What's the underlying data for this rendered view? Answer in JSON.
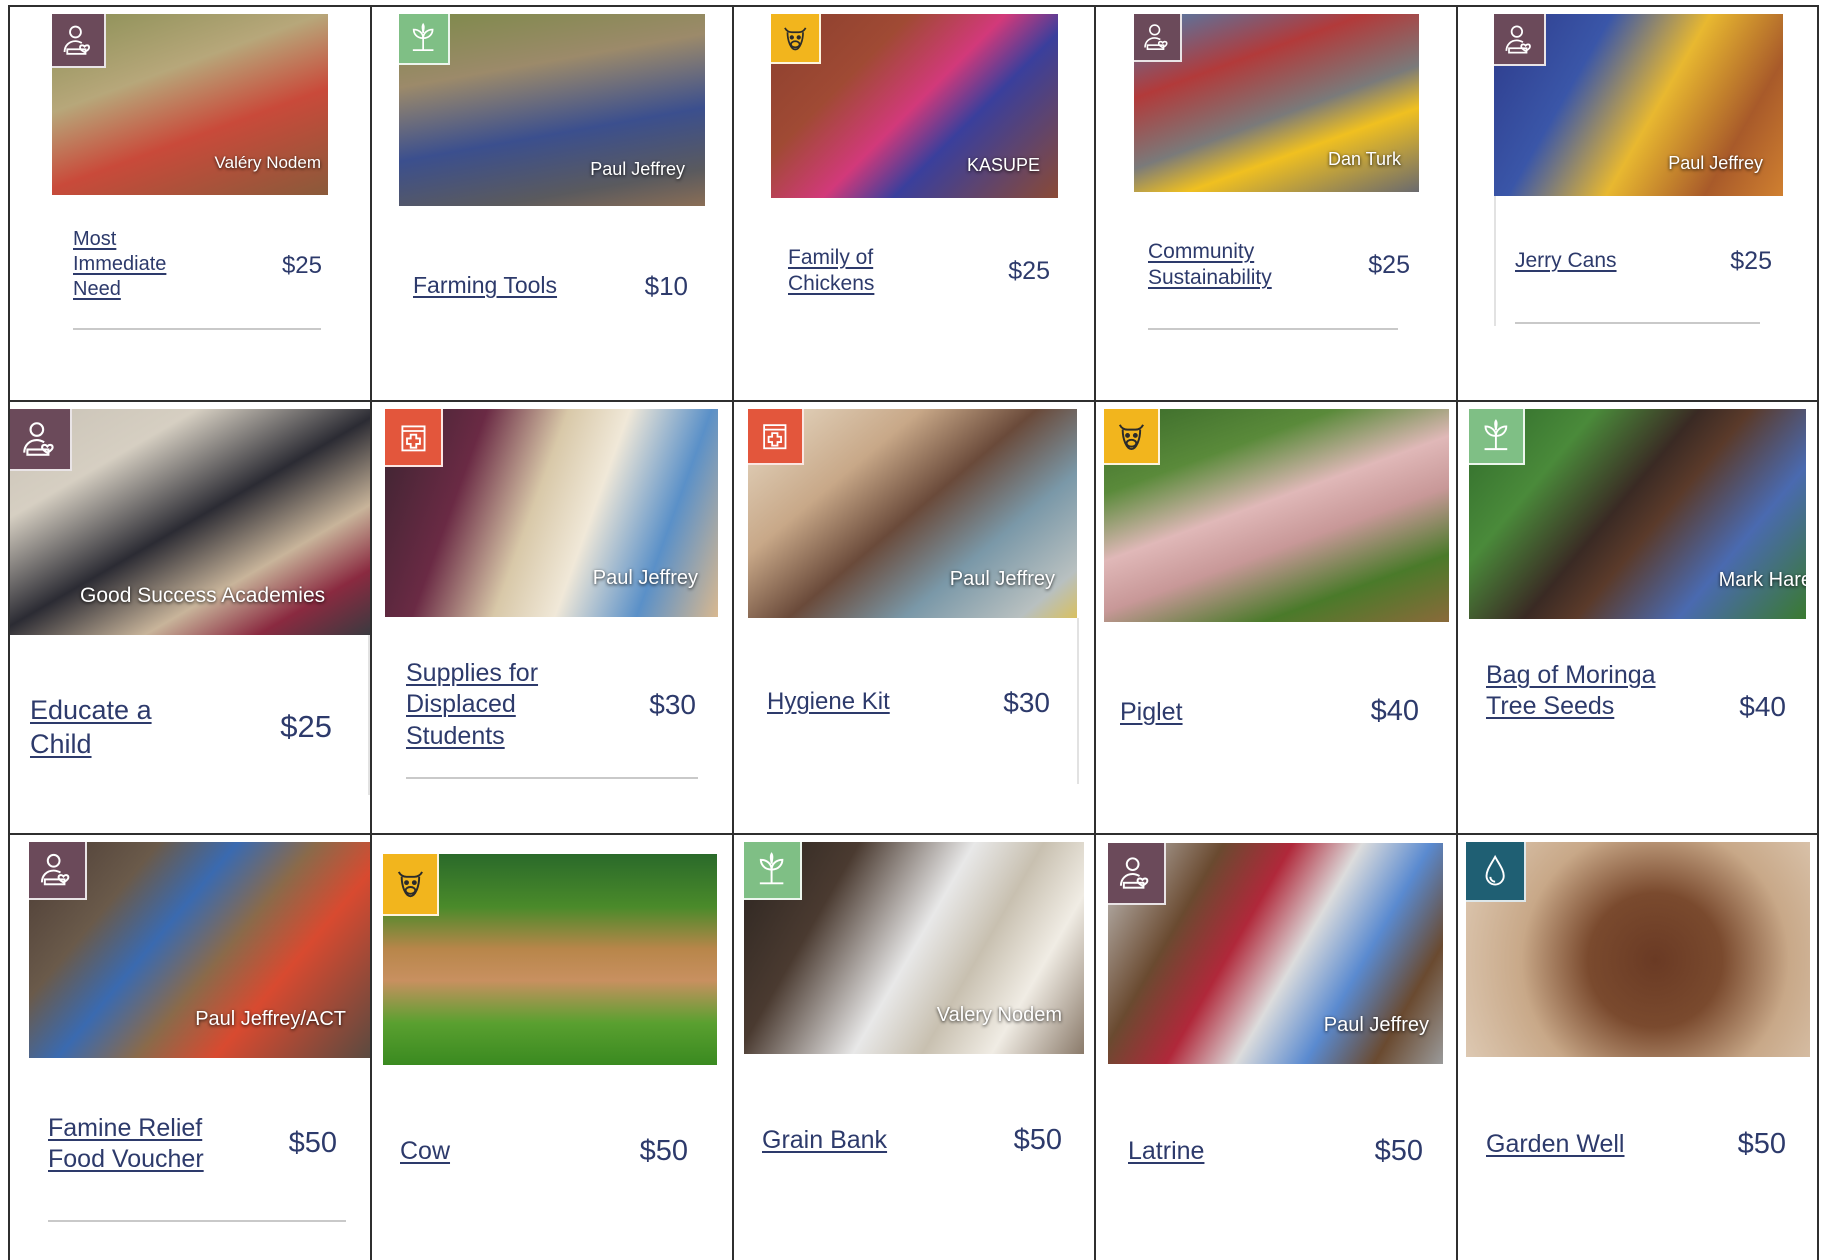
{
  "colors": {
    "text_navy": "#2d3a6b",
    "grid_line": "#2f2f2f",
    "badge_person": "#6b4a5a",
    "badge_plant": "#7fbf85",
    "badge_animal": "#f2b51d",
    "badge_health": "#e3563c",
    "badge_water": "#1f5f73"
  },
  "gifts": [
    {
      "name": "Most Immediate Need",
      "price": "$25",
      "credit": "Valéry Nodem",
      "icon": "person-heart-icon"
    },
    {
      "name": "Farming Tools",
      "price": "$10",
      "credit": "Paul Jeffrey",
      "icon": "seedling-icon"
    },
    {
      "name": "Family of Chickens",
      "price": "$25",
      "credit": "KASUPE",
      "icon": "cow-icon"
    },
    {
      "name": "Community Sustainability",
      "price": "$25",
      "credit": "Dan Turk",
      "icon": "person-heart-icon"
    },
    {
      "name": "Jerry Cans",
      "price": "$25",
      "credit": "Paul Jeffrey",
      "icon": "person-heart-icon"
    },
    {
      "name": "Educate a Child",
      "price": "$25",
      "credit": "Good Success Academies",
      "icon": "person-heart-icon"
    },
    {
      "name": "Supplies for Displaced Students",
      "price": "$30",
      "credit": "Paul Jeffrey",
      "icon": "medical-cross-icon"
    },
    {
      "name": "Hygiene Kit",
      "price": "$30",
      "credit": "Paul Jeffrey",
      "icon": "medical-cross-icon"
    },
    {
      "name": "Piglet",
      "price": "$40",
      "credit": "",
      "icon": "cow-icon"
    },
    {
      "name": "Bag of Moringa Tree Seeds",
      "price": "$40",
      "credit": "Mark Hare",
      "icon": "seedling-icon"
    },
    {
      "name": "Famine Relief Food Voucher",
      "price": "$50",
      "credit": "Paul Jeffrey/ACT",
      "icon": "person-heart-icon"
    },
    {
      "name": "Cow",
      "price": "$50",
      "credit": "",
      "icon": "cow-icon"
    },
    {
      "name": "Grain Bank",
      "price": "$50",
      "credit": "Valery Nodem",
      "icon": "seedling-icon"
    },
    {
      "name": "Latrine",
      "price": "$50",
      "credit": "Paul Jeffrey",
      "icon": "person-heart-icon"
    },
    {
      "name": "Garden Well",
      "price": "$50",
      "credit": "",
      "icon": "water-drop-icon"
    }
  ]
}
